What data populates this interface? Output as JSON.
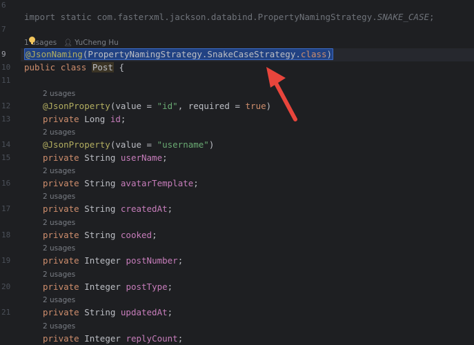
{
  "editor": {
    "line_numbers": [
      "6",
      "7",
      "9",
      "10",
      "11",
      "12",
      "13",
      "14",
      "15",
      "16",
      "17",
      "18",
      "19",
      "20",
      "21"
    ],
    "import_line": {
      "prefix": "import static com.fasterxml.jackson.databind.PropertyNamingStrategy.",
      "constant": "SNAKE_CASE",
      "suffix": ";"
    },
    "hint_class": {
      "usages": "1 usages",
      "author_icon": "person-icon",
      "author": "YuCheng Hu"
    },
    "annotation_line": {
      "annotation": "@JsonNaming",
      "open": "(",
      "class_ref": "PropertyNamingStrategy.SnakeCaseStrategy",
      "dot": ".",
      "kw": "class",
      "close": ")"
    },
    "class_decl": {
      "kw1": "public",
      "kw2": "class",
      "name": "Post",
      "brace": "{"
    },
    "usage_hint": "2 usages",
    "json_property_id": {
      "annotation": "@JsonProperty",
      "open": "(value = ",
      "value": "\"id\"",
      "mid": ", required = ",
      "bool": "true",
      "close": ")"
    },
    "json_property_username": {
      "annotation": "@JsonProperty",
      "open": "(value = ",
      "value": "\"username\"",
      "close": ")"
    },
    "fields": [
      {
        "mod": "private",
        "type": "Long",
        "name": "id"
      },
      {
        "mod": "private",
        "type": "String",
        "name": "userName"
      },
      {
        "mod": "private",
        "type": "String",
        "name": "avatarTemplate"
      },
      {
        "mod": "private",
        "type": "String",
        "name": "createdAt"
      },
      {
        "mod": "private",
        "type": "String",
        "name": "cooked"
      },
      {
        "mod": "private",
        "type": "Integer",
        "name": "postNumber"
      },
      {
        "mod": "private",
        "type": "Integer",
        "name": "postType"
      },
      {
        "mod": "private",
        "type": "String",
        "name": "updatedAt"
      },
      {
        "mod": "private",
        "type": "Integer",
        "name": "replyCount"
      }
    ],
    "semicolon": ";"
  },
  "colors": {
    "background": "#1e1f22",
    "selection": "#214283",
    "arrow": "#e8453c"
  }
}
